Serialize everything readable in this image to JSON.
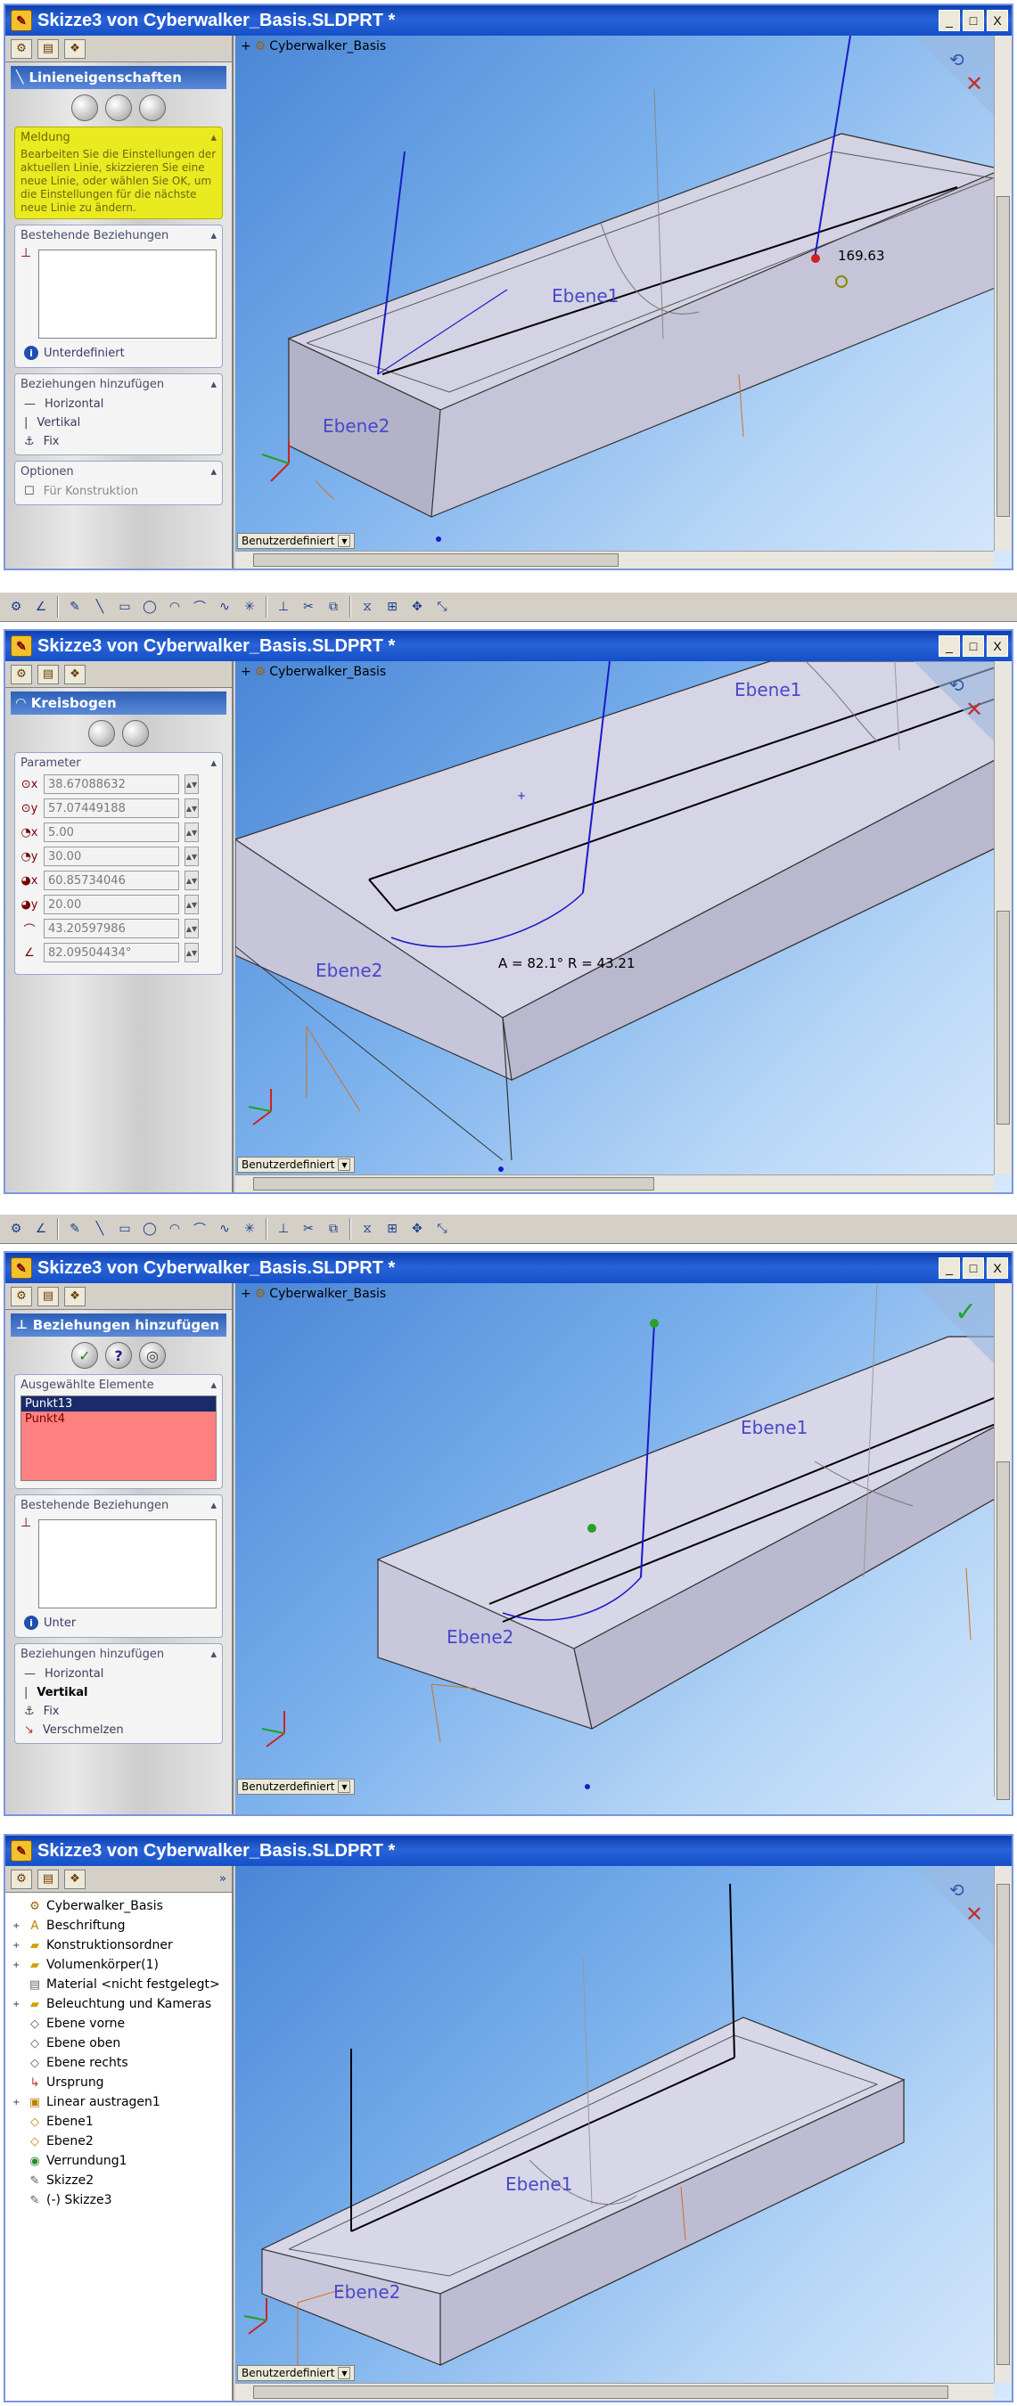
{
  "window_title": "Skizze3 von Cyberwalker_Basis.SLDPRT *",
  "title_controls": {
    "minimize": "_",
    "maximize": "□",
    "close": "X"
  },
  "model_tree_root": "Cyberwalker_Basis",
  "view_orientation": "Benutzerdefiniert",
  "planes": {
    "ebene1": "Ebene1",
    "ebene2": "Ebene2"
  },
  "panel1": {
    "title": "Linieneigenschaften",
    "message_head": "Meldung",
    "message": "Bearbeiten Sie die Einstellungen der aktuellen Linie, skizzieren Sie eine neue Linie, oder wählen Sie OK, um die Einstellungen für die nächste neue Linie zu ändern.",
    "existing_head": "Bestehende Beziehungen",
    "status": "Unterdefiniert",
    "add_head": "Beziehungen hinzufügen",
    "relations": [
      "Horizontal",
      "Vertikal",
      "Fix"
    ],
    "options_head": "Optionen",
    "construction": "Für Konstruktion",
    "dimension": "169.63"
  },
  "panel2": {
    "title": "Kreisbogen",
    "param_head": "Parameter",
    "params": [
      "38.67088632",
      "57.07449188",
      "5.00",
      "30.00",
      "60.85734046",
      "20.00",
      "43.20597986",
      "82.09504434°"
    ],
    "arc_label": "A = 82.1° R = 43.21"
  },
  "panel3": {
    "title": "Beziehungen hinzufügen",
    "selected_head": "Ausgewählte Elemente",
    "selected": [
      "Punkt13",
      "Punkt4"
    ],
    "existing_head": "Bestehende Beziehungen",
    "status": "Unter",
    "add_head": "Beziehungen hinzufügen",
    "relations": [
      "Horizontal",
      "Vertikal",
      "Fix",
      "Verschmelzen"
    ]
  },
  "panel4": {
    "tree": [
      "Cyberwalker_Basis",
      "Beschriftung",
      "Konstruktionsordner",
      "Volumenkörper(1)",
      "Material <nicht festgelegt>",
      "Beleuchtung und Kameras",
      "Ebene vorne",
      "Ebene oben",
      "Ebene rechts",
      "Ursprung",
      "Linear austragen1",
      "Ebene1",
      "Ebene2",
      "Verrundung1",
      "Skizze2",
      "(-) Skizze3"
    ]
  },
  "colors": {
    "title_bar": "#1450c8",
    "message_bg": "#eaea20",
    "selection_bg": "#ff8080",
    "sketch_line": "#1a1ac8",
    "plane_label": "#4a48c8"
  }
}
